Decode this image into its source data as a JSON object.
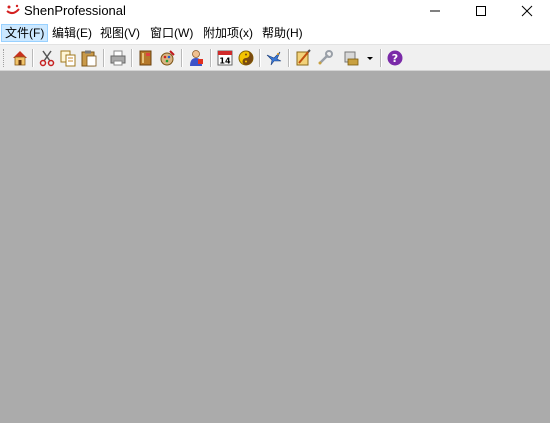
{
  "window": {
    "title": "ShenProfessional",
    "app_icon": "red-swoosh-icon",
    "controls": [
      "minimize-icon",
      "maximize-icon",
      "close-icon"
    ]
  },
  "menu": {
    "file": "文件(F)",
    "edit": "编辑(E)",
    "view": "视图(V)",
    "window": "窗口(W)",
    "addons": "附加项(x)",
    "help": "帮助(H)"
  },
  "toolbar": {
    "calendar_day": "14",
    "buttons": [
      "home-icon",
      "cut-icon",
      "copy-icon",
      "paste-icon",
      "print-icon",
      "book-icon",
      "color-palette-icon",
      "person-icon",
      "calendar-icon",
      "yinyang-icon",
      "bird-icon",
      "note-icon",
      "wrench-icon",
      "stamp-icon",
      "dropdown-arrow-icon",
      "help-icon"
    ]
  },
  "colors": {
    "client_background": "#ababab",
    "toolbar_background": "#f0f0f0",
    "menu_highlight": "#cce8ff",
    "help_icon": "#7a2aa8"
  }
}
